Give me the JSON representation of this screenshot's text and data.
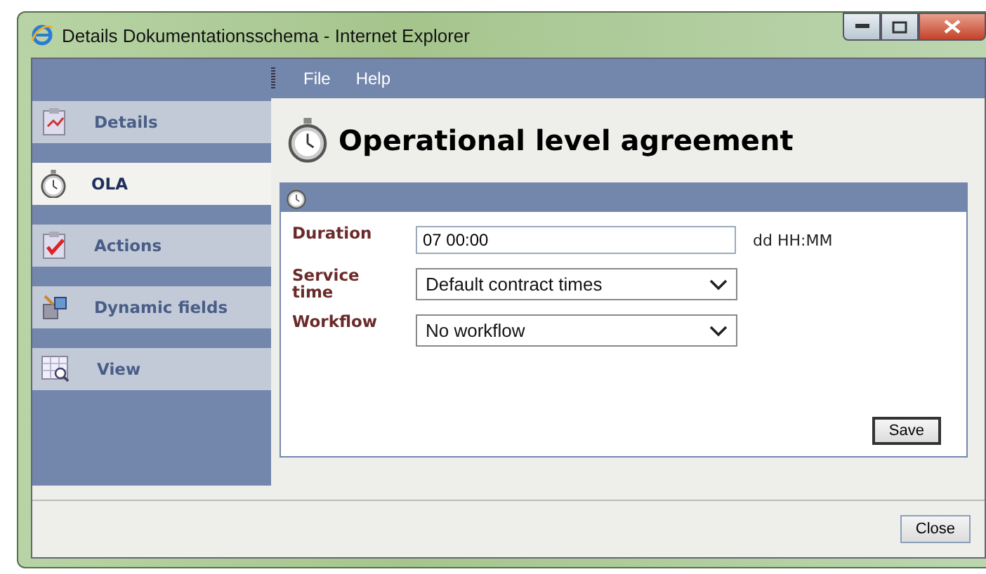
{
  "window": {
    "title": "Details Dokumentationsschema - Internet Explorer"
  },
  "menu": [
    "File",
    "Help"
  ],
  "sidebar": {
    "items": [
      {
        "label": "Details",
        "selected": false
      },
      {
        "label": "OLA",
        "selected": true
      },
      {
        "label": "Actions",
        "selected": false
      },
      {
        "label": "Dynamic fields",
        "selected": false
      },
      {
        "label": "View",
        "selected": false
      }
    ]
  },
  "heading": "Operational level agreement",
  "form": {
    "fields": [
      {
        "kind": "text",
        "label": "Duration",
        "value": "07 00:00",
        "hint": "dd HH:MM"
      },
      {
        "kind": "select",
        "label": "Service time",
        "value": "Default contract times"
      },
      {
        "kind": "select",
        "label": "Workflow",
        "value": "No workflow"
      }
    ],
    "save": "Save"
  },
  "footer": {
    "close": "Close"
  }
}
